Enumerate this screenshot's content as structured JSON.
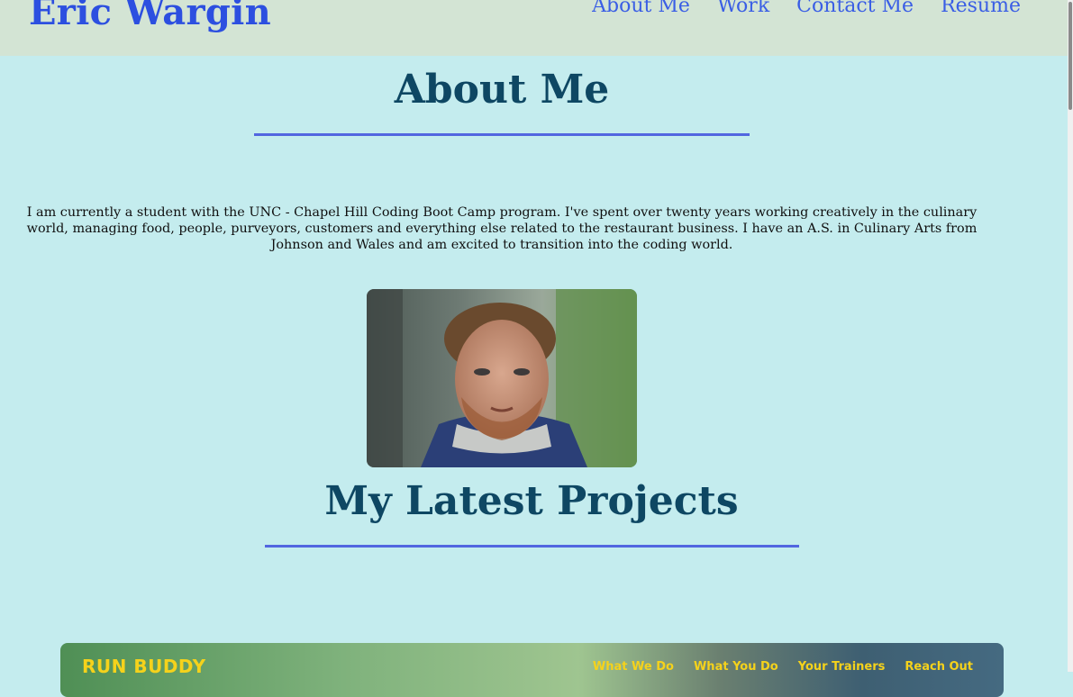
{
  "header": {
    "brand": "Eric Wargin",
    "nav": [
      "About Me",
      "Work",
      "Contact Me",
      "Resume"
    ]
  },
  "about": {
    "title": "About Me",
    "text": "I am currently a student with the UNC - Chapel Hill Coding Boot Camp program. I've spent over twenty years working creatively in the culinary world, managing food, people, purveyors, customers and everything else related to the restaurant business. I have an A.S. in Culinary Arts from Johnson and Wales and am excited to transition into the coding world."
  },
  "projects": {
    "title": "My Latest Projects",
    "card": {
      "logo": "RUN BUDDY",
      "nav": [
        "What We Do",
        "What You Do",
        "Your Trainers",
        "Reach Out"
      ]
    }
  },
  "colors": {
    "background": "#c4ecee",
    "header": "#d3e4d4",
    "brand": "#2c4fe0",
    "heading": "#0e4763",
    "rule": "#5266e0",
    "project_accent": "#f5d21b"
  }
}
